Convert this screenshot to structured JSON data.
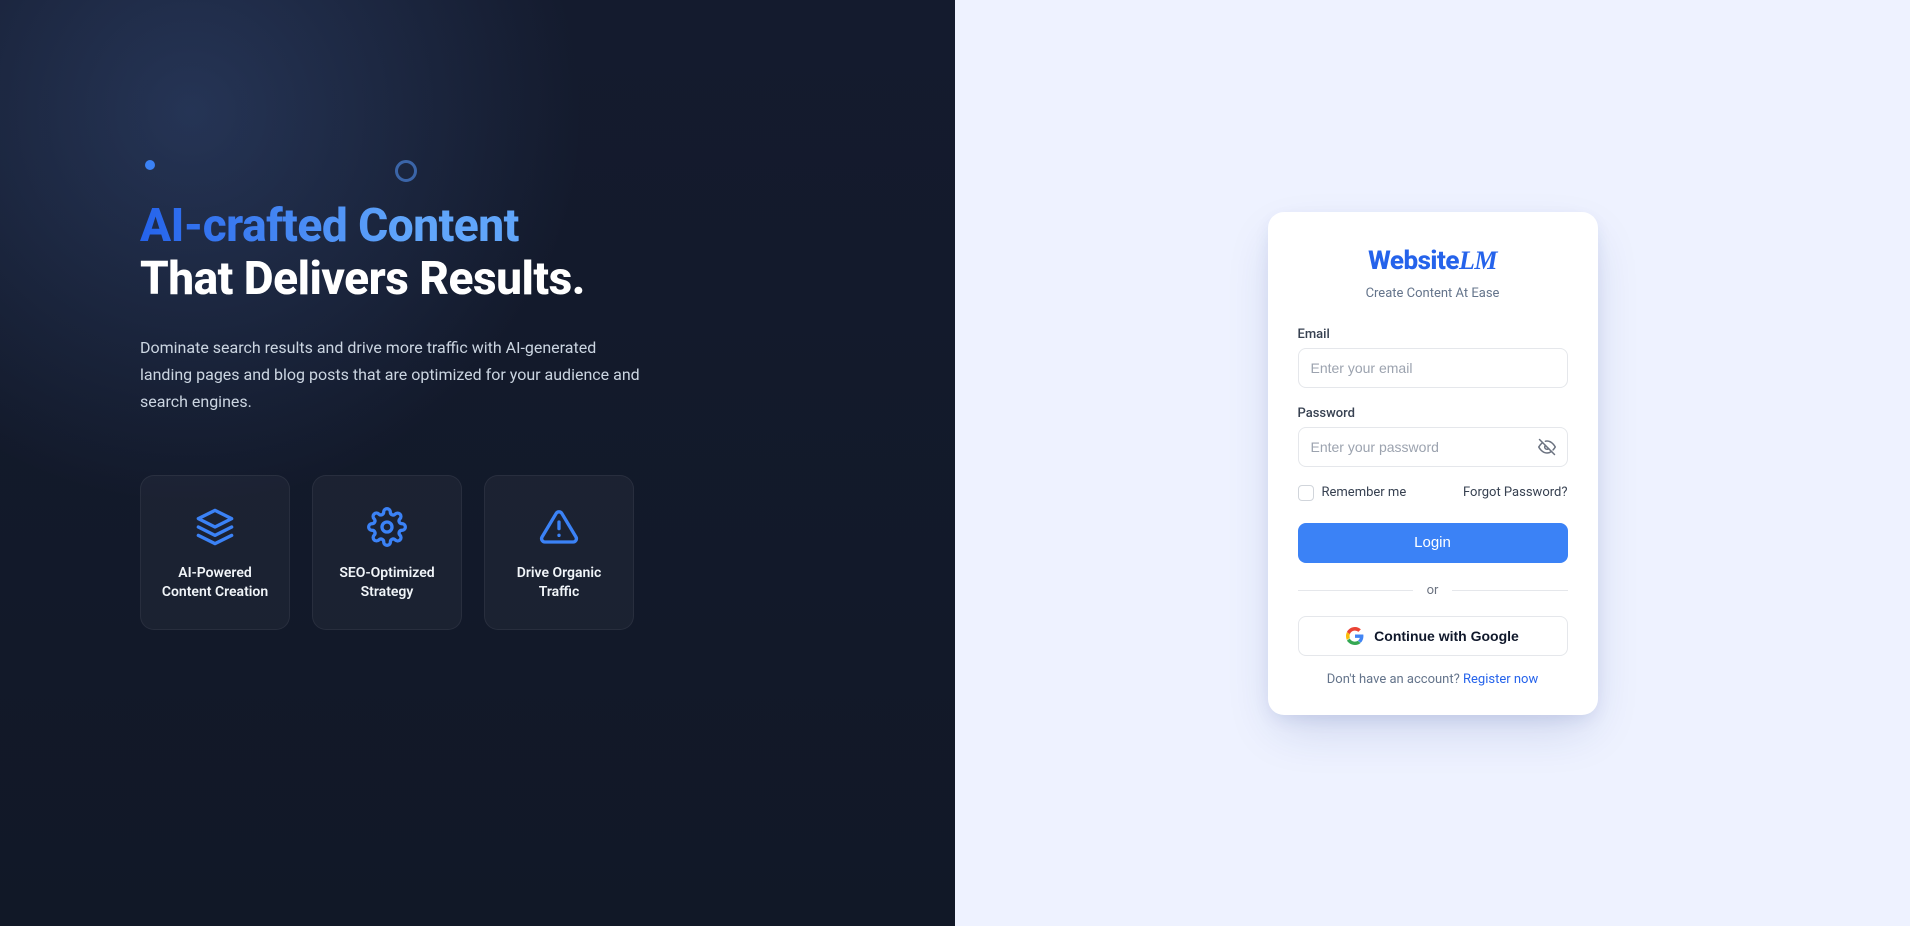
{
  "hero": {
    "headline_accent": "AI-crafted Content",
    "headline_plain": "That Delivers Results.",
    "sub": "Dominate search results and drive more traffic with AI-generated landing pages and blog posts that are optimized for your audience and search engines.",
    "cards": [
      {
        "label": "AI-Powered Content Creation"
      },
      {
        "label": "SEO-Optimized Strategy"
      },
      {
        "label": "Drive Organic Traffic"
      }
    ]
  },
  "auth": {
    "brand_main": "Website",
    "brand_lm": "LM",
    "tagline": "Create Content At Ease",
    "email_label": "Email",
    "email_placeholder": "Enter your email",
    "password_label": "Password",
    "password_placeholder": "Enter your password",
    "remember_label": "Remember me",
    "forgot_label": "Forgot Password?",
    "login_label": "Login",
    "or_label": "or",
    "google_label": "Continue with Google",
    "register_prompt": "Don't have an account? ",
    "register_link": "Register now"
  }
}
